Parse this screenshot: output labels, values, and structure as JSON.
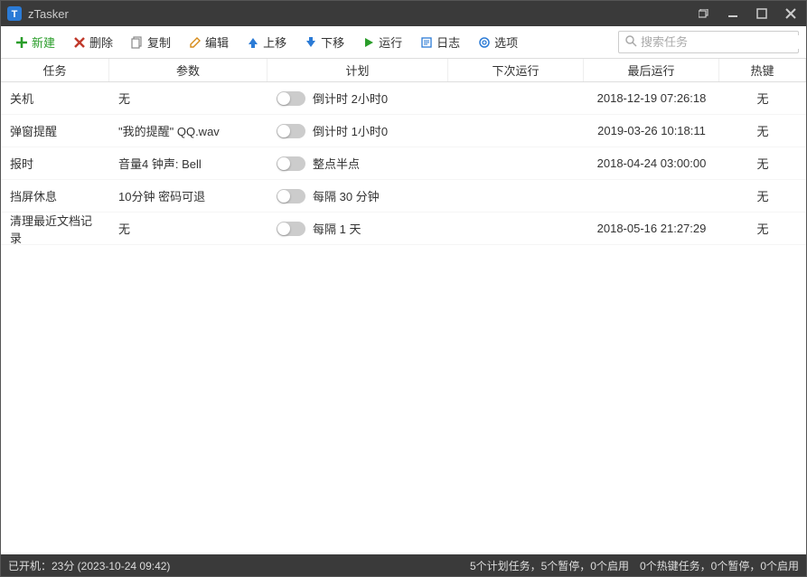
{
  "app": {
    "title": "zTasker"
  },
  "toolbar": {
    "new": "新建",
    "delete": "删除",
    "copy": "复制",
    "edit": "编辑",
    "moveup": "上移",
    "movedown": "下移",
    "run": "运行",
    "log": "日志",
    "options": "选项"
  },
  "search": {
    "placeholder": "搜索任务"
  },
  "columns": {
    "task": "任务",
    "param": "参数",
    "plan": "计划",
    "next": "下次运行",
    "last": "最后运行",
    "hotkey": "热键"
  },
  "tasks": [
    {
      "task": "关机",
      "param": "无",
      "plan": "倒计时 2小时0",
      "next": "",
      "last": "2018-12-19 07:26:18",
      "hotkey": "无"
    },
    {
      "task": "弹窗提醒",
      "param": "\"我的提醒\" QQ.wav",
      "plan": "倒计时 1小时0",
      "next": "",
      "last": "2019-03-26 10:18:11",
      "hotkey": "无"
    },
    {
      "task": "报时",
      "param": "音量4 钟声: Bell",
      "plan": "整点半点",
      "next": "",
      "last": "2018-04-24 03:00:00",
      "hotkey": "无"
    },
    {
      "task": "挡屏休息",
      "param": "10分钟 密码可退",
      "plan": "每隔 30 分钟",
      "next": "",
      "last": "",
      "hotkey": "无"
    },
    {
      "task": "清理最近文档记录",
      "param": "无",
      "plan": "每隔 1 天",
      "next": "",
      "last": "2018-05-16 21:27:29",
      "hotkey": "无"
    }
  ],
  "status": {
    "left": "已开机：23分 (2023-10-24 09:42)",
    "right": "5个计划任务，5个暂停，0个启用　0个热键任务，0个暂停，0个启用"
  }
}
